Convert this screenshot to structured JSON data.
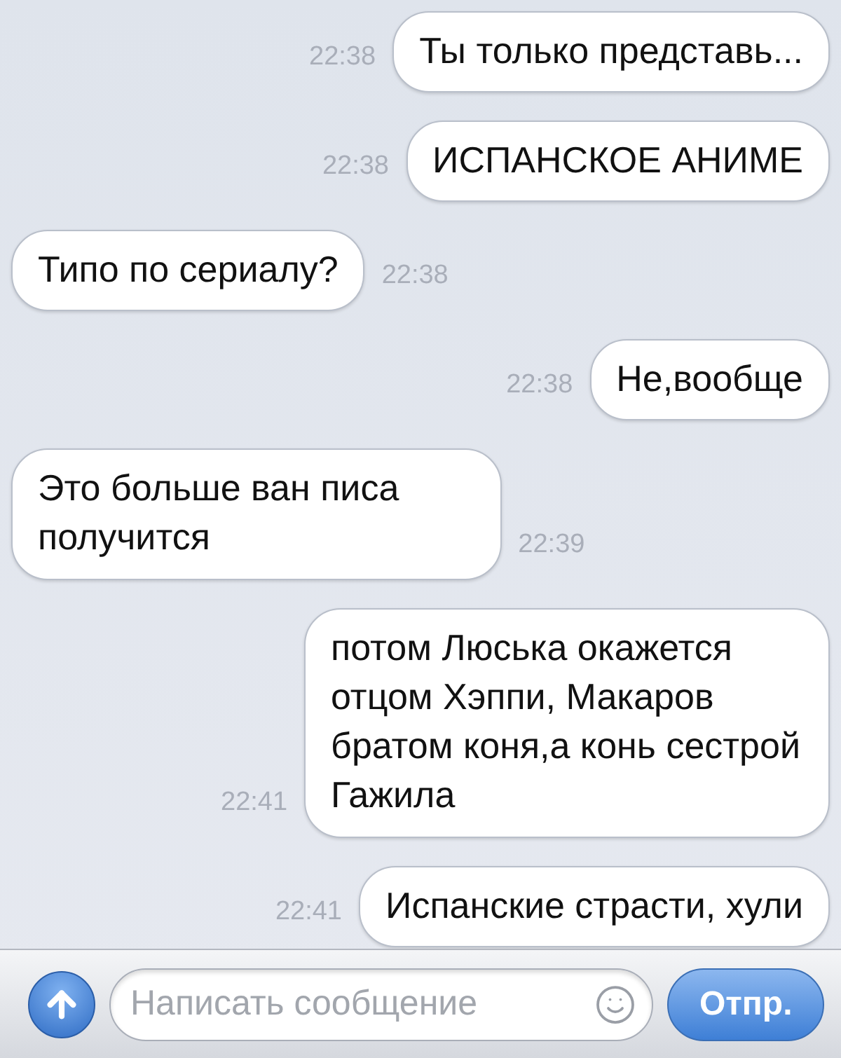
{
  "messages": [
    {
      "kind": "outgoing",
      "text": "Ты только представь...",
      "time": "22:38"
    },
    {
      "kind": "outgoing",
      "text": "ИСПАНСКОЕ АНИМЕ",
      "time": "22:38"
    },
    {
      "kind": "incoming",
      "text": "Типо по сериалу?",
      "time": "22:38"
    },
    {
      "kind": "outgoing",
      "text": "Не,вообще",
      "time": "22:38"
    },
    {
      "kind": "incoming",
      "text": "Это больше ван писа\nполучится",
      "time": "22:39"
    },
    {
      "kind": "outgoing",
      "text": "потом Люська окажется\nотцом Хэппи, Макаров\nбратом коня,а конь сестрой\nГажила",
      "time": "22:41"
    },
    {
      "kind": "outgoing",
      "text": "Испанские страсти, хули",
      "time": "22:41"
    }
  ],
  "composer": {
    "placeholder": "Написать сообщение",
    "send": "Отпр."
  }
}
